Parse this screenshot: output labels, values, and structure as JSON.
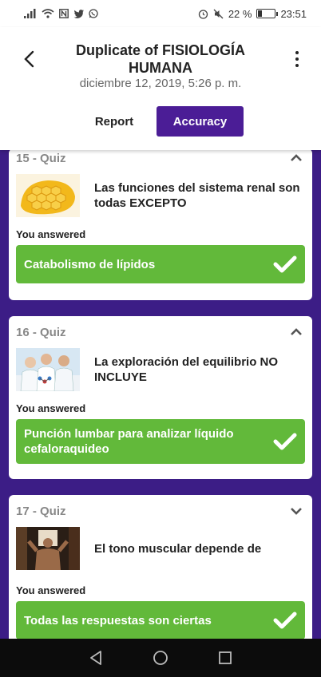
{
  "status": {
    "battery_percent": "22 %",
    "time": "23:51",
    "battery_level": 0.22
  },
  "header": {
    "title": "Duplicate of FISIOLOGÍA HUMANA",
    "subtitle": "diciembre 12, 2019, 5:26 p. m.",
    "tabs": [
      {
        "label": "Report",
        "active": false
      },
      {
        "label": "Accuracy",
        "active": true
      }
    ]
  },
  "colors": {
    "accent": "#4b1d96",
    "background": "#3c1d86",
    "correct": "#62b93a"
  },
  "quizzes": [
    {
      "number": "15 - Quiz",
      "question": "Las funciones del sistema renal son todas EXCEPTO",
      "you_answered": "You answered",
      "answer": "Catabolismo de lípidos",
      "expanded": true,
      "icon": "honeycomb-image"
    },
    {
      "number": "16 - Quiz",
      "question": "La exploración del equilibrio NO INCLUYE",
      "you_answered": "You answered",
      "answer": "Punción lumbar para analizar líquido cefaloraquideo",
      "expanded": true,
      "icon": "scientists-image"
    },
    {
      "number": "17 - Quiz",
      "question": "El tono muscular depende de",
      "you_answered": "You answered",
      "answer": "Todas las respuestas son ciertas",
      "expanded": false,
      "icon": "muscles-image"
    }
  ]
}
